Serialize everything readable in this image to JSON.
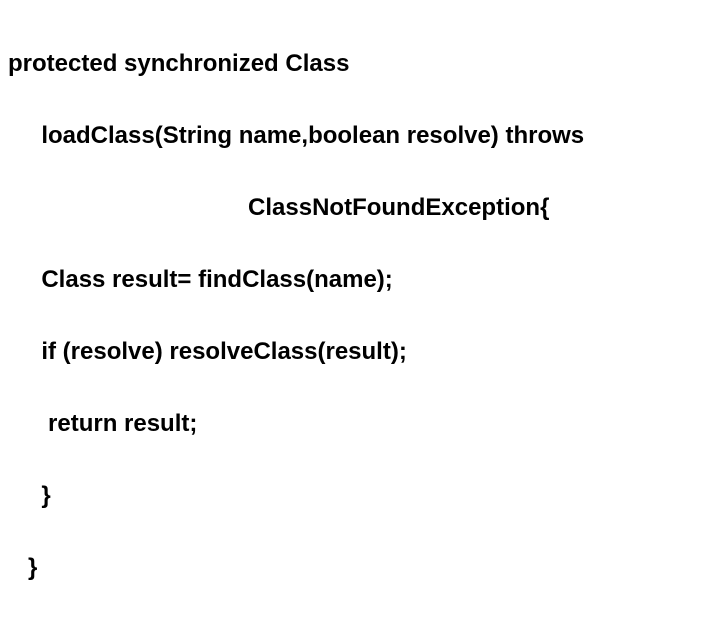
{
  "code": {
    "l1": "protected synchronized Class",
    "l2": "     loadClass(String name,boolean resolve) throws",
    "l3": "                                    ClassNotFoundException{",
    "l4": "     Class result= findClass(name);",
    "l5": "     if (resolve) resolveClass(result);",
    "l6": "      return result;",
    "l7": "     }",
    "l8": "   }"
  }
}
